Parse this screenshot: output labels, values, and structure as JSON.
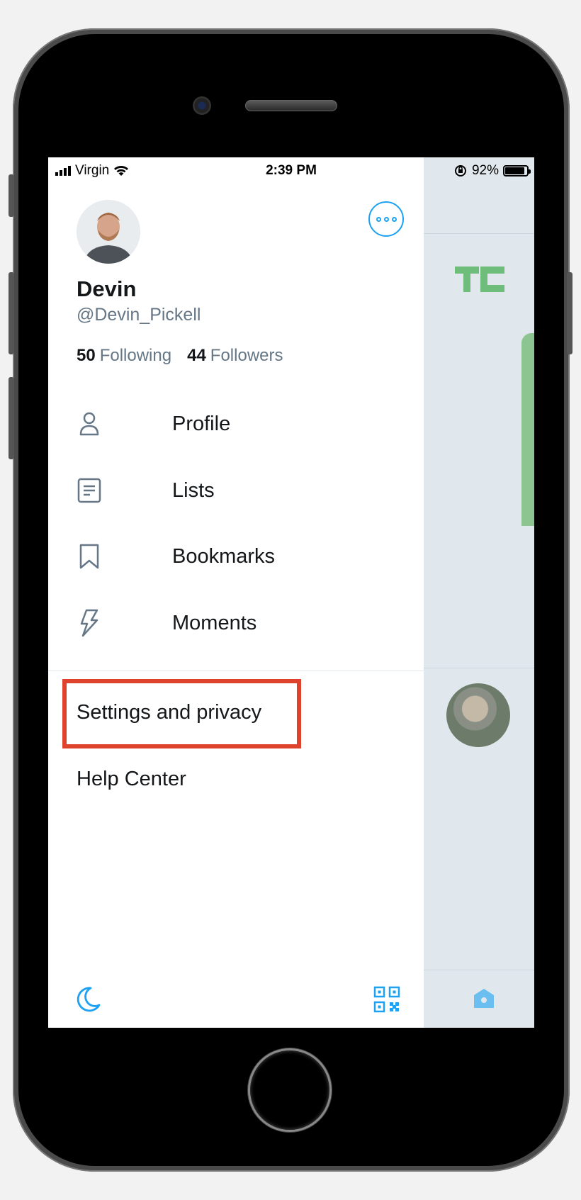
{
  "status_bar": {
    "carrier": "Virgin",
    "time": "2:39 PM",
    "battery_percent": "92%"
  },
  "profile": {
    "name": "Devin",
    "handle": "@Devin_Pickell",
    "following_count": "50",
    "following_label": "Following",
    "followers_count": "44",
    "followers_label": "Followers"
  },
  "menu": [
    {
      "label": "Profile",
      "icon": "person-icon"
    },
    {
      "label": "Lists",
      "icon": "list-icon"
    },
    {
      "label": "Bookmarks",
      "icon": "bookmark-icon"
    },
    {
      "label": "Moments",
      "icon": "lightning-icon"
    }
  ],
  "secondary_menu": {
    "settings": "Settings and privacy",
    "help": "Help Center"
  },
  "colors": {
    "accent": "#1da1f2",
    "highlight_box": "#e0432d",
    "text_primary": "#14171a",
    "text_secondary": "#657786"
  }
}
